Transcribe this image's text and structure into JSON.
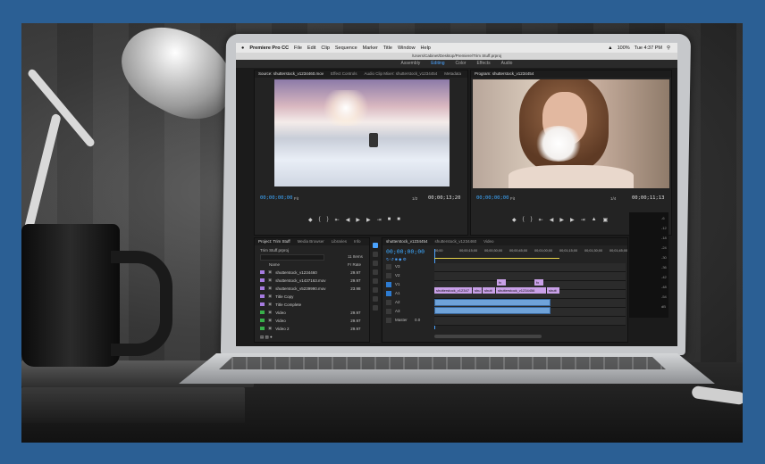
{
  "menubar": {
    "app_name": "Premiere Pro CC",
    "items": [
      "File",
      "Edit",
      "Clip",
      "Sequence",
      "Marker",
      "Title",
      "Window",
      "Help"
    ],
    "battery": "100%",
    "clock": "Tue 4:37 PM"
  },
  "window_title": "/Users/Cabinet/Desktop/Premiere/Trim Stuff.prproj",
  "workspaces": {
    "items": [
      "Assembly",
      "Editing",
      "Color",
      "Effects",
      "Audio"
    ],
    "active": "Editing"
  },
  "source_monitor": {
    "tabs": [
      "Source: shutterstock_v1234460.mov",
      "Effect Controls",
      "Audio Clip Mixer: shutterstock_v1234454",
      "Metadata"
    ],
    "timecode_in": "00;00;00;00",
    "fit": "Fit",
    "ratio": "1/2",
    "timecode_out": "00;00;13;20"
  },
  "program_monitor": {
    "tab": "Program: shutterstock_v1234454",
    "timecode_in": "00;00;00;00",
    "fit": "Fit",
    "ratio": "1/4",
    "timecode_out": "00;00;11;13"
  },
  "project_panel": {
    "tabs": [
      "Project: Trim Stuff",
      "Media Browser",
      "Libraries",
      "Info"
    ],
    "project_name": "Trim Stuff.prproj",
    "count": "11 Items",
    "col_name": "Name",
    "col_rate": "Fr Rate",
    "items": [
      {
        "name": "shutterstock_v1234460",
        "rate": "29.97",
        "color": "#a67be0"
      },
      {
        "name": "shutterstock_v1437163.mov",
        "rate": "29.97",
        "color": "#a67be0"
      },
      {
        "name": "shutterstock_v5239990.mov",
        "rate": "23.98",
        "color": "#a67be0"
      },
      {
        "name": "Title Copy",
        "rate": "",
        "color": "#a67be0"
      },
      {
        "name": "Title Complete",
        "rate": "",
        "color": "#a67be0"
      },
      {
        "name": "Video",
        "rate": "29.97",
        "color": "#38b04a"
      },
      {
        "name": "Video",
        "rate": "29.97",
        "color": "#38b04a"
      },
      {
        "name": "Video 2",
        "rate": "29.97",
        "color": "#38b04a"
      }
    ]
  },
  "timeline": {
    "tabs": [
      "shutterstock_v1234454",
      "shutterstock_v1234460",
      "Video"
    ],
    "timecode": "00;00;00;00",
    "ruler": [
      "00;00",
      "00;00;15;00",
      "00;00;30;00",
      "00;00;45;00",
      "00;01;00;00",
      "00;01;15;00",
      "00;01;30;00",
      "00;01;45;00"
    ],
    "tracks": [
      "V3",
      "V2",
      "V1",
      "A1",
      "A2",
      "A3",
      "Master"
    ],
    "master_value": "0.0",
    "clips_v1": [
      {
        "label": "shutterstock_v12347",
        "color": "#c9a0e8"
      },
      {
        "label": "shu",
        "color": "#c9a0e8"
      },
      {
        "label": "shutt",
        "color": "#c9a0e8"
      },
      {
        "label": "shutterstock_v1234456",
        "color": "#c9a0e8"
      },
      {
        "label": "shutt",
        "color": "#c9a0e8"
      }
    ],
    "fx_badges": [
      "fx",
      "fx"
    ]
  },
  "audio_meter": {
    "labels": [
      "-6",
      "-12",
      "-18",
      "-24",
      "-30",
      "-36",
      "-42",
      "-48",
      "-54",
      "dB"
    ]
  }
}
